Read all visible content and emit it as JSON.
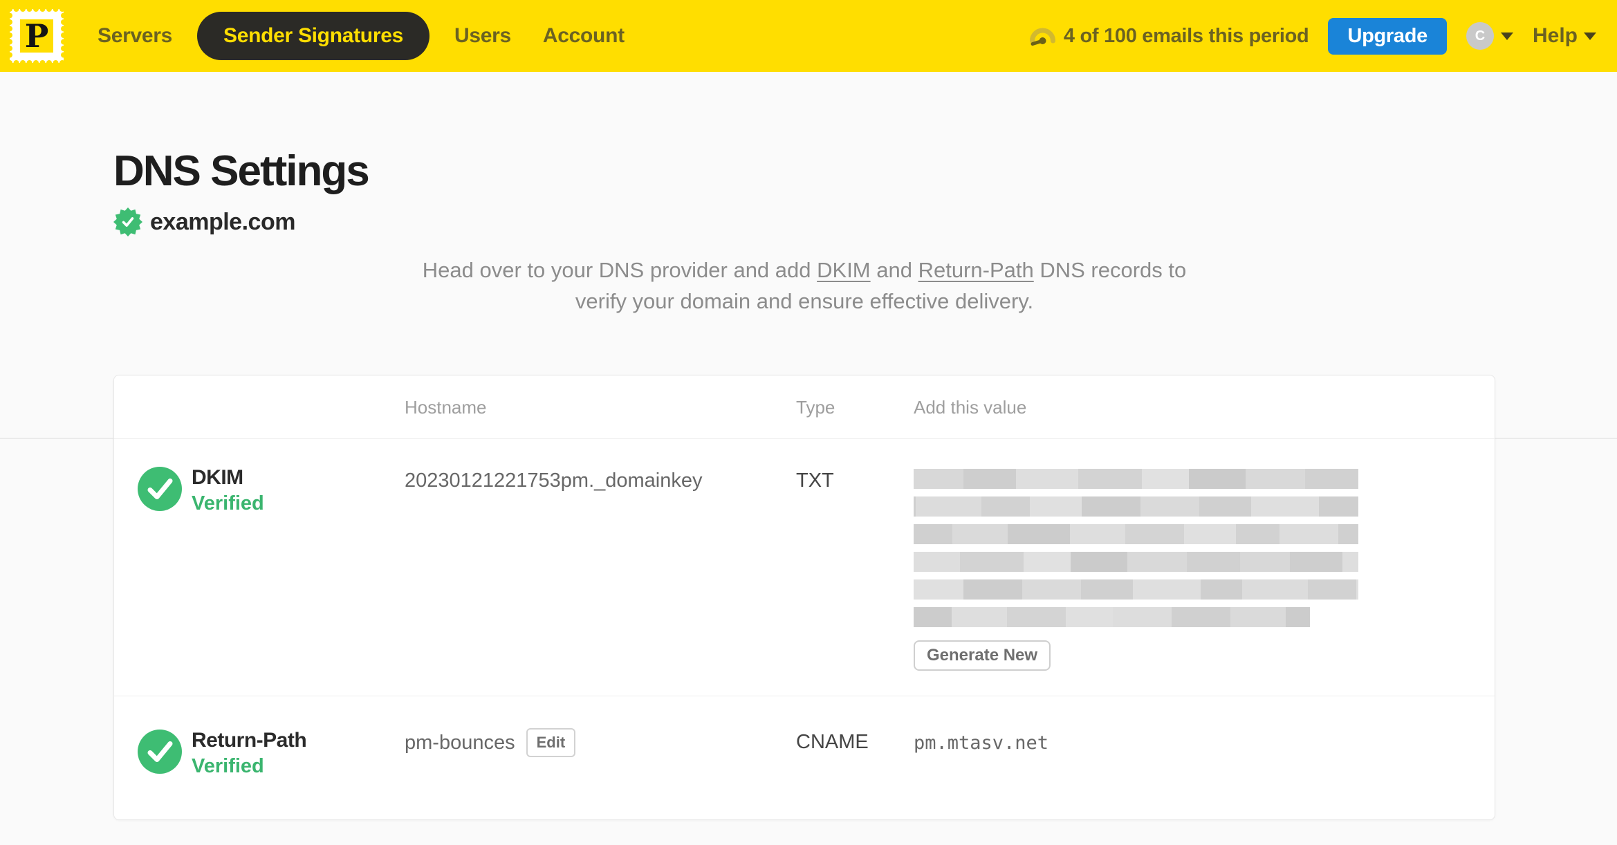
{
  "nav": {
    "logo_letter": "P",
    "items": [
      {
        "label": "Servers",
        "active": false
      },
      {
        "label": "Sender Signatures",
        "active": true
      },
      {
        "label": "Users",
        "active": false
      },
      {
        "label": "Account",
        "active": false
      }
    ],
    "usage_text": "4 of 100 emails this period",
    "upgrade_label": "Upgrade",
    "avatar_initial": "C",
    "help_label": "Help"
  },
  "page": {
    "title": "DNS Settings",
    "domain": "example.com",
    "domain_verified": true,
    "intro_before": "Head over to your DNS provider and add ",
    "intro_link_dkim": "DKIM",
    "intro_between": " and ",
    "intro_link_return_path": "Return-Path",
    "intro_after": " DNS records to verify your domain and ensure effective delivery."
  },
  "table": {
    "headers": {
      "hostname": "Hostname",
      "type": "Type",
      "value": "Add this value"
    },
    "rows": [
      {
        "name": "DKIM",
        "status": "Verified",
        "hostname": "20230121221753pm._domainkey",
        "type": "TXT",
        "value_redacted": true,
        "redacted_lines": 6,
        "action_label": "Generate New"
      },
      {
        "name": "Return-Path",
        "status": "Verified",
        "hostname": "pm-bounces",
        "edit_label": "Edit",
        "type": "CNAME",
        "value": "pm.mtasv.net"
      }
    ]
  },
  "colors": {
    "brand_yellow": "#FFDE00",
    "nav_text_olive": "#6B6222",
    "active_pill_bg": "#2B2A26",
    "accent_blue": "#1A84D8",
    "success_green": "#3EBD73",
    "intro_gray": "#8C8C8C"
  }
}
